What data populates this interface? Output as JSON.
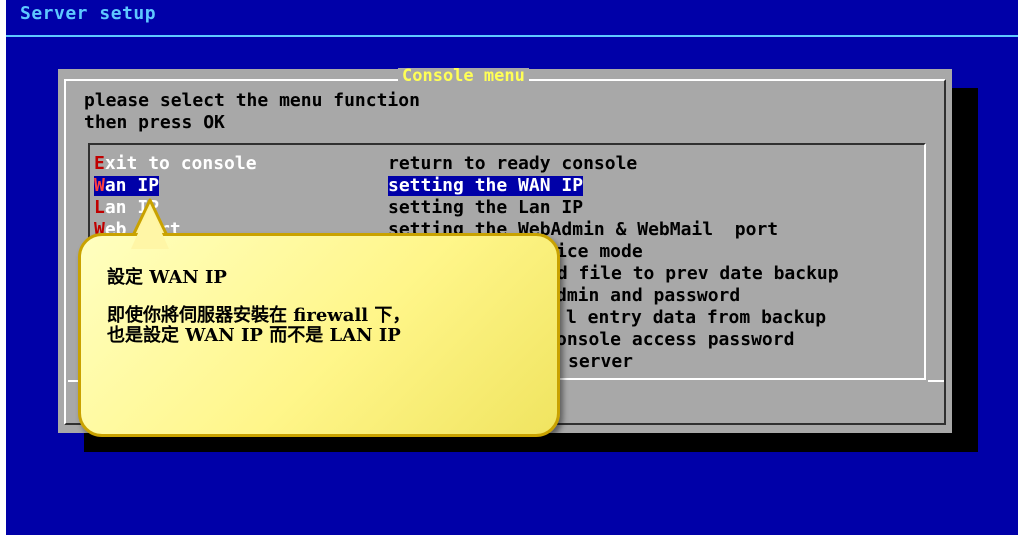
{
  "screen": {
    "title": "Server setup"
  },
  "dialog": {
    "title": "Console menu",
    "prompt": [
      "please select the menu function",
      "then press OK"
    ],
    "items": [
      {
        "hotkey": "E",
        "rest": "xit to console",
        "desc": "return to ready console"
      },
      {
        "hotkey": "W",
        "rest": "an IP",
        "desc": "setting the WAN IP",
        "selected": true
      },
      {
        "hotkey": "L",
        "rest": "an IP",
        "desc": "setting the Lan IP"
      },
      {
        "hotkey": "W",
        "rest": "eb Port",
        "desc": "setting the WebAdmin & WebMail  port"
      }
    ],
    "partial_lines": [
      "ice mode",
      "rd file to prev date backup",
      "dmin and password",
      "l entry data from backup",
      "onsole access password",
      "server"
    ]
  },
  "callout": {
    "title": "設定 WAN IP",
    "body": [
      "即使你將伺服器安裝在 firewall 下，",
      "也是設定 WAN IP 而不是 LAN IP"
    ]
  },
  "colors": {
    "screen_bg": "#0000a8",
    "dialog_bg": "#a8a8a8",
    "highlight": "#0000a8",
    "hotkey": "#c00000",
    "dialog_title": "#ffff55",
    "callout_bg": "#fff68a"
  }
}
